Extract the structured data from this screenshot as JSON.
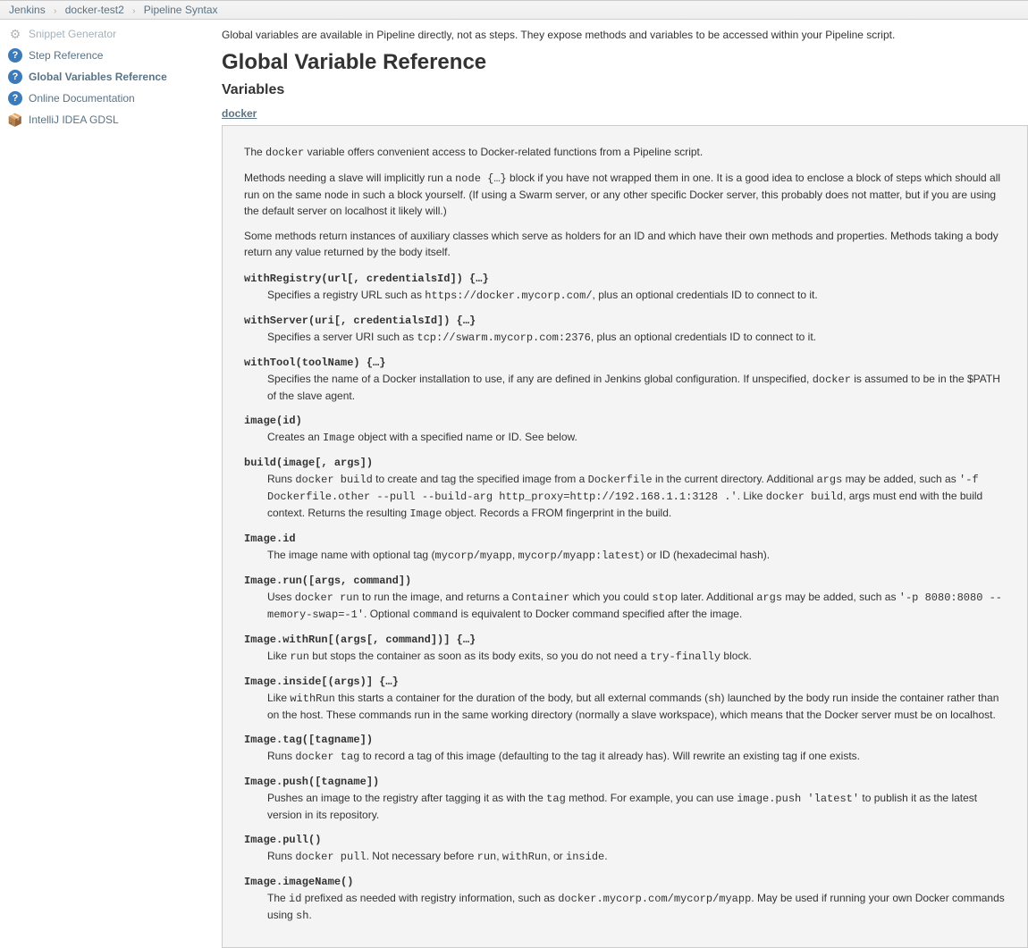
{
  "breadcrumb": {
    "items": [
      "Jenkins",
      "docker-test2",
      "Pipeline Syntax"
    ]
  },
  "sidebar": {
    "items": [
      {
        "label": "Snippet Generator",
        "icon": "gear"
      },
      {
        "label": "Step Reference",
        "icon": "q"
      },
      {
        "label": "Global Variables Reference",
        "icon": "q",
        "bold": true
      },
      {
        "label": "Online Documentation",
        "icon": "q"
      },
      {
        "label": "IntelliJ IDEA GDSL",
        "icon": "box"
      }
    ]
  },
  "intro": "Global variables are available in Pipeline directly, not as steps. They expose methods and variables to be accessed within your Pipeline script.",
  "heading": "Global Variable Reference",
  "subheading": "Variables",
  "var_link": "docker",
  "doc": {
    "p1a": "The ",
    "p1_code": "docker",
    "p1b": " variable offers convenient access to Docker-related functions from a Pipeline script.",
    "p2a": "Methods needing a slave will implicitly run a ",
    "p2_code": "node {…}",
    "p2b": " block if you have not wrapped them in one. It is a good idea to enclose a block of steps which should all run on the same node in such a block yourself. (If using a Swarm server, or any other specific Docker server, this probably does not matter, but if you are using the default server on localhost it likely will.)",
    "p3": "Some methods return instances of auxiliary classes which serve as holders for an ID and which have their own methods and properties. Methods taking a body return any value returned by the body itself.",
    "methods": [
      {
        "sig": "withRegistry(url[, credentialsId]) {…}",
        "parts": [
          "Specifies a registry URL such as ",
          "https://docker.mycorp.com/",
          ", plus an optional credentials ID to connect to it."
        ]
      },
      {
        "sig": "withServer(uri[, credentialsId]) {…}",
        "parts": [
          "Specifies a server URI such as ",
          "tcp://swarm.mycorp.com:2376",
          ", plus an optional credentials ID to connect to it."
        ]
      },
      {
        "sig": "withTool(toolName) {…}",
        "parts": [
          "Specifies the name of a Docker installation to use, if any are defined in Jenkins global configuration. If unspecified, ",
          "docker",
          " is assumed to be in the $PATH of the slave agent."
        ]
      },
      {
        "sig": "image(id)",
        "parts": [
          "Creates an ",
          "Image",
          " object with a specified name or ID. See below."
        ]
      },
      {
        "sig": "build(image[, args])",
        "parts": [
          "Runs ",
          "docker build",
          " to create and tag the specified image from a ",
          "Dockerfile",
          " in the current directory. Additional ",
          "args",
          " may be added, such as ",
          "'-f Dockerfile.other --pull --build-arg http_proxy=http://192.168.1.1:3128 .'",
          ". Like ",
          "docker build",
          ", args must end with the build context. Returns the resulting ",
          "Image",
          " object. Records a FROM fingerprint in the build."
        ]
      },
      {
        "sig": "Image.id",
        "parts": [
          "The image name with optional tag (",
          "mycorp/myapp",
          ", ",
          "mycorp/myapp:latest",
          ") or ID (hexadecimal hash)."
        ]
      },
      {
        "sig": "Image.run([args, command])",
        "parts": [
          "Uses ",
          "docker run",
          " to run the image, and returns a ",
          "Container",
          " which you could ",
          "stop",
          " later. Additional ",
          "args",
          " may be added, such as ",
          "'-p 8080:8080 --memory-swap=-1'",
          ". Optional ",
          "command",
          " is equivalent to Docker command specified after the image."
        ]
      },
      {
        "sig": "Image.withRun[(args[, command])] {…}",
        "parts": [
          "Like ",
          "run",
          " but stops the container as soon as its body exits, so you do not need a ",
          "try-finally",
          " block."
        ]
      },
      {
        "sig": "Image.inside[(args)] {…}",
        "parts": [
          "Like ",
          "withRun",
          " this starts a container for the duration of the body, but all external commands (",
          "sh",
          ") launched by the body run inside the container rather than on the host. These commands run in the same working directory (normally a slave workspace), which means that the Docker server must be on localhost."
        ]
      },
      {
        "sig": "Image.tag([tagname])",
        "parts": [
          "Runs ",
          "docker tag",
          " to record a tag of this image (defaulting to the tag it already has). Will rewrite an existing tag if one exists."
        ]
      },
      {
        "sig": "Image.push([tagname])",
        "parts": [
          "Pushes an image to the registry after tagging it as with the ",
          "tag",
          " method. For example, you can use ",
          "image.push 'latest'",
          " to publish it as the latest version in its repository."
        ]
      },
      {
        "sig": "Image.pull()",
        "parts": [
          "Runs ",
          "docker pull",
          ". Not necessary before ",
          "run",
          ", ",
          "withRun",
          ", or ",
          "inside",
          "."
        ]
      },
      {
        "sig": "Image.imageName()",
        "parts": [
          "The ",
          "id",
          " prefixed as needed with registry information, such as ",
          "docker.mycorp.com/mycorp/myapp",
          ". May be used if running your own Docker commands using ",
          "sh",
          "."
        ]
      }
    ]
  }
}
